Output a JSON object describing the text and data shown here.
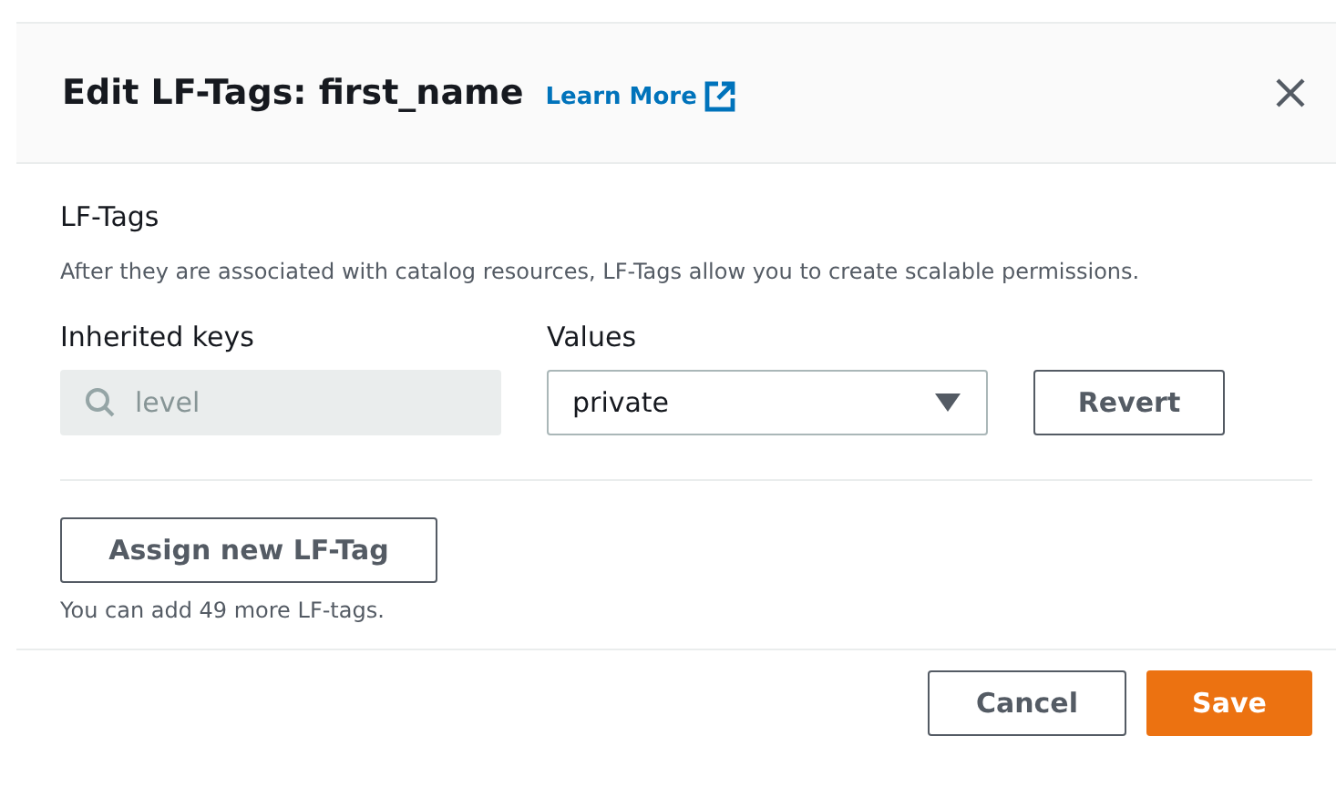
{
  "modal": {
    "title": "Edit LF-Tags: first_name",
    "learn_more": "Learn More"
  },
  "section": {
    "heading": "LF-Tags",
    "description": "After they are associated with catalog resources, LF-Tags allow you to create scalable permissions."
  },
  "tags": [
    {
      "key_label": "Inherited keys",
      "key_value": "level",
      "key_disabled": true,
      "values_label": "Values",
      "value": "private",
      "revert": "Revert"
    }
  ],
  "assign_button": "Assign new LF-Tag",
  "hint": "You can add 49 more LF-tags.",
  "buttons": {
    "cancel": "Cancel",
    "save": "Save"
  }
}
